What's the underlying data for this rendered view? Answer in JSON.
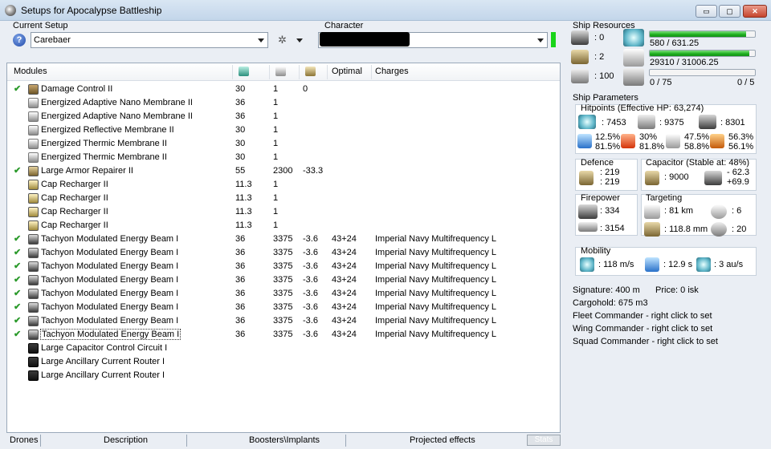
{
  "window": {
    "title": "Setups for Apocalypse Battleship",
    "min_glyph": "▭",
    "max_glyph": "▢",
    "close_glyph": "✕"
  },
  "setup": {
    "label": "Current Setup",
    "value": "Carebaer",
    "help_glyph": "?",
    "tool_glyph": "✲"
  },
  "character": {
    "label": "Character"
  },
  "modules": {
    "headers": {
      "name": "Modules",
      "optimal": "Optimal",
      "charges": "Charges"
    },
    "rows": [
      {
        "check": true,
        "icon": "dc",
        "name": "Damage Control II",
        "c1": "30",
        "c2": "1",
        "c3": "0",
        "c4": "",
        "c5": ""
      },
      {
        "check": false,
        "icon": "mem",
        "name": "Energized Adaptive Nano Membrane II",
        "c1": "36",
        "c2": "1",
        "c3": "",
        "c4": "",
        "c5": ""
      },
      {
        "check": false,
        "icon": "mem",
        "name": "Energized Adaptive Nano Membrane II",
        "c1": "36",
        "c2": "1",
        "c3": "",
        "c4": "",
        "c5": ""
      },
      {
        "check": false,
        "icon": "mem",
        "name": "Energized Reflective Membrane II",
        "c1": "30",
        "c2": "1",
        "c3": "",
        "c4": "",
        "c5": ""
      },
      {
        "check": false,
        "icon": "mem",
        "name": "Energized Thermic Membrane II",
        "c1": "30",
        "c2": "1",
        "c3": "",
        "c4": "",
        "c5": ""
      },
      {
        "check": false,
        "icon": "mem",
        "name": "Energized Thermic Membrane II",
        "c1": "30",
        "c2": "1",
        "c3": "",
        "c4": "",
        "c5": ""
      },
      {
        "check": true,
        "icon": "rep",
        "name": "Large Armor Repairer II",
        "c1": "55",
        "c2": "2300",
        "c3": "-33.3",
        "c4": "",
        "c5": ""
      },
      {
        "check": false,
        "icon": "cap",
        "name": "Cap Recharger II",
        "c1": "11.3",
        "c2": "1",
        "c3": "",
        "c4": "",
        "c5": ""
      },
      {
        "check": false,
        "icon": "cap",
        "name": "Cap Recharger II",
        "c1": "11.3",
        "c2": "1",
        "c3": "",
        "c4": "",
        "c5": ""
      },
      {
        "check": false,
        "icon": "cap",
        "name": "Cap Recharger II",
        "c1": "11.3",
        "c2": "1",
        "c3": "",
        "c4": "",
        "c5": ""
      },
      {
        "check": false,
        "icon": "cap",
        "name": "Cap Recharger II",
        "c1": "11.3",
        "c2": "1",
        "c3": "",
        "c4": "",
        "c5": ""
      },
      {
        "check": true,
        "icon": "beam",
        "name": "Tachyon Modulated Energy Beam I",
        "c1": "36",
        "c2": "3375",
        "c3": "-3.6",
        "c4": "43+24",
        "c5": "Imperial Navy Multifrequency L"
      },
      {
        "check": true,
        "icon": "beam",
        "name": "Tachyon Modulated Energy Beam I",
        "c1": "36",
        "c2": "3375",
        "c3": "-3.6",
        "c4": "43+24",
        "c5": "Imperial Navy Multifrequency L"
      },
      {
        "check": true,
        "icon": "beam",
        "name": "Tachyon Modulated Energy Beam I",
        "c1": "36",
        "c2": "3375",
        "c3": "-3.6",
        "c4": "43+24",
        "c5": "Imperial Navy Multifrequency L"
      },
      {
        "check": true,
        "icon": "beam",
        "name": "Tachyon Modulated Energy Beam I",
        "c1": "36",
        "c2": "3375",
        "c3": "-3.6",
        "c4": "43+24",
        "c5": "Imperial Navy Multifrequency L"
      },
      {
        "check": true,
        "icon": "beam",
        "name": "Tachyon Modulated Energy Beam I",
        "c1": "36",
        "c2": "3375",
        "c3": "-3.6",
        "c4": "43+24",
        "c5": "Imperial Navy Multifrequency L"
      },
      {
        "check": true,
        "icon": "beam",
        "name": "Tachyon Modulated Energy Beam I",
        "c1": "36",
        "c2": "3375",
        "c3": "-3.6",
        "c4": "43+24",
        "c5": "Imperial Navy Multifrequency L"
      },
      {
        "check": true,
        "icon": "beam",
        "name": "Tachyon Modulated Energy Beam I",
        "c1": "36",
        "c2": "3375",
        "c3": "-3.6",
        "c4": "43+24",
        "c5": "Imperial Navy Multifrequency L"
      },
      {
        "check": true,
        "icon": "beam",
        "name": "Tachyon Modulated Energy Beam I",
        "c1": "36",
        "c2": "3375",
        "c3": "-3.6",
        "c4": "43+24",
        "c5": "Imperial Navy Multifrequency L",
        "selected": true
      },
      {
        "check": false,
        "icon": "rig",
        "name": "Large Capacitor Control Circuit I",
        "c1": "",
        "c2": "",
        "c3": "",
        "c4": "",
        "c5": ""
      },
      {
        "check": false,
        "icon": "rig",
        "name": "Large Ancillary Current Router I",
        "c1": "",
        "c2": "",
        "c3": "",
        "c4": "",
        "c5": ""
      },
      {
        "check": false,
        "icon": "rig",
        "name": "Large Ancillary Current Router I",
        "c1": "",
        "c2": "",
        "c3": "",
        "c4": "",
        "c5": ""
      }
    ]
  },
  "tabs": {
    "drones": "Drones",
    "description": "Description",
    "boosters": "Boosters\\Implants",
    "projected": "Projected effects",
    "stats": "Stats"
  },
  "resources": {
    "label": "Ship Resources",
    "turret_slots": ": 0",
    "launcher_slots": ": 2",
    "calibration": ": 100",
    "cpu_text": "580 / 631.25",
    "cpu_fraction": 0.919,
    "power_text": "29310 / 31006.25",
    "power_fraction": 0.945,
    "drone_bay_text": "0 / 75",
    "drone_bay_fraction": 0.0,
    "drones_active_text": "0 / 5"
  },
  "parameters": {
    "label": "Ship Parameters",
    "hitpoints_label": "Hitpoints (Effective HP: 63,274)",
    "shield_hp": ": 7453",
    "armor_hp": ": 9375",
    "structure_hp": ": 8301",
    "res_em": [
      "12.5%",
      "81.5%"
    ],
    "res_therm": [
      "30%",
      "81.8%"
    ],
    "res_kin": [
      "47.5%",
      "58.8%"
    ],
    "res_exp": [
      "56.3%",
      "56.1%"
    ],
    "defence_label": "Defence",
    "defence_a": ": 219",
    "defence_b": ": 219",
    "capacitor_label": "Capacitor (Stable at: 48%)",
    "capacitor_amount": ": 9000",
    "capacitor_delta_a": "- 62.3",
    "capacitor_delta_b": "+69.9",
    "firepower_label": "Firepower",
    "firepower_a": ": 334",
    "firepower_b": ": 3154",
    "targeting_label": "Targeting",
    "target_range": ": 81 km",
    "max_targets": ": 6",
    "scan_res": ": 118.8 mm",
    "sensor_strength": ": 20",
    "mobility_label": "Mobility",
    "velocity": ": 118 m/s",
    "align_time": ": 12.9 s",
    "warp_speed": ": 3 au/s"
  },
  "info": {
    "signature": "Signature: 400 m",
    "price": "Price: 0 isk",
    "cargohold": "Cargohold: 675 m3",
    "fleet": "Fleet Commander - right click to set",
    "wing": "Wing Commander - right click to set",
    "squad": "Squad Commander - right click to set"
  }
}
